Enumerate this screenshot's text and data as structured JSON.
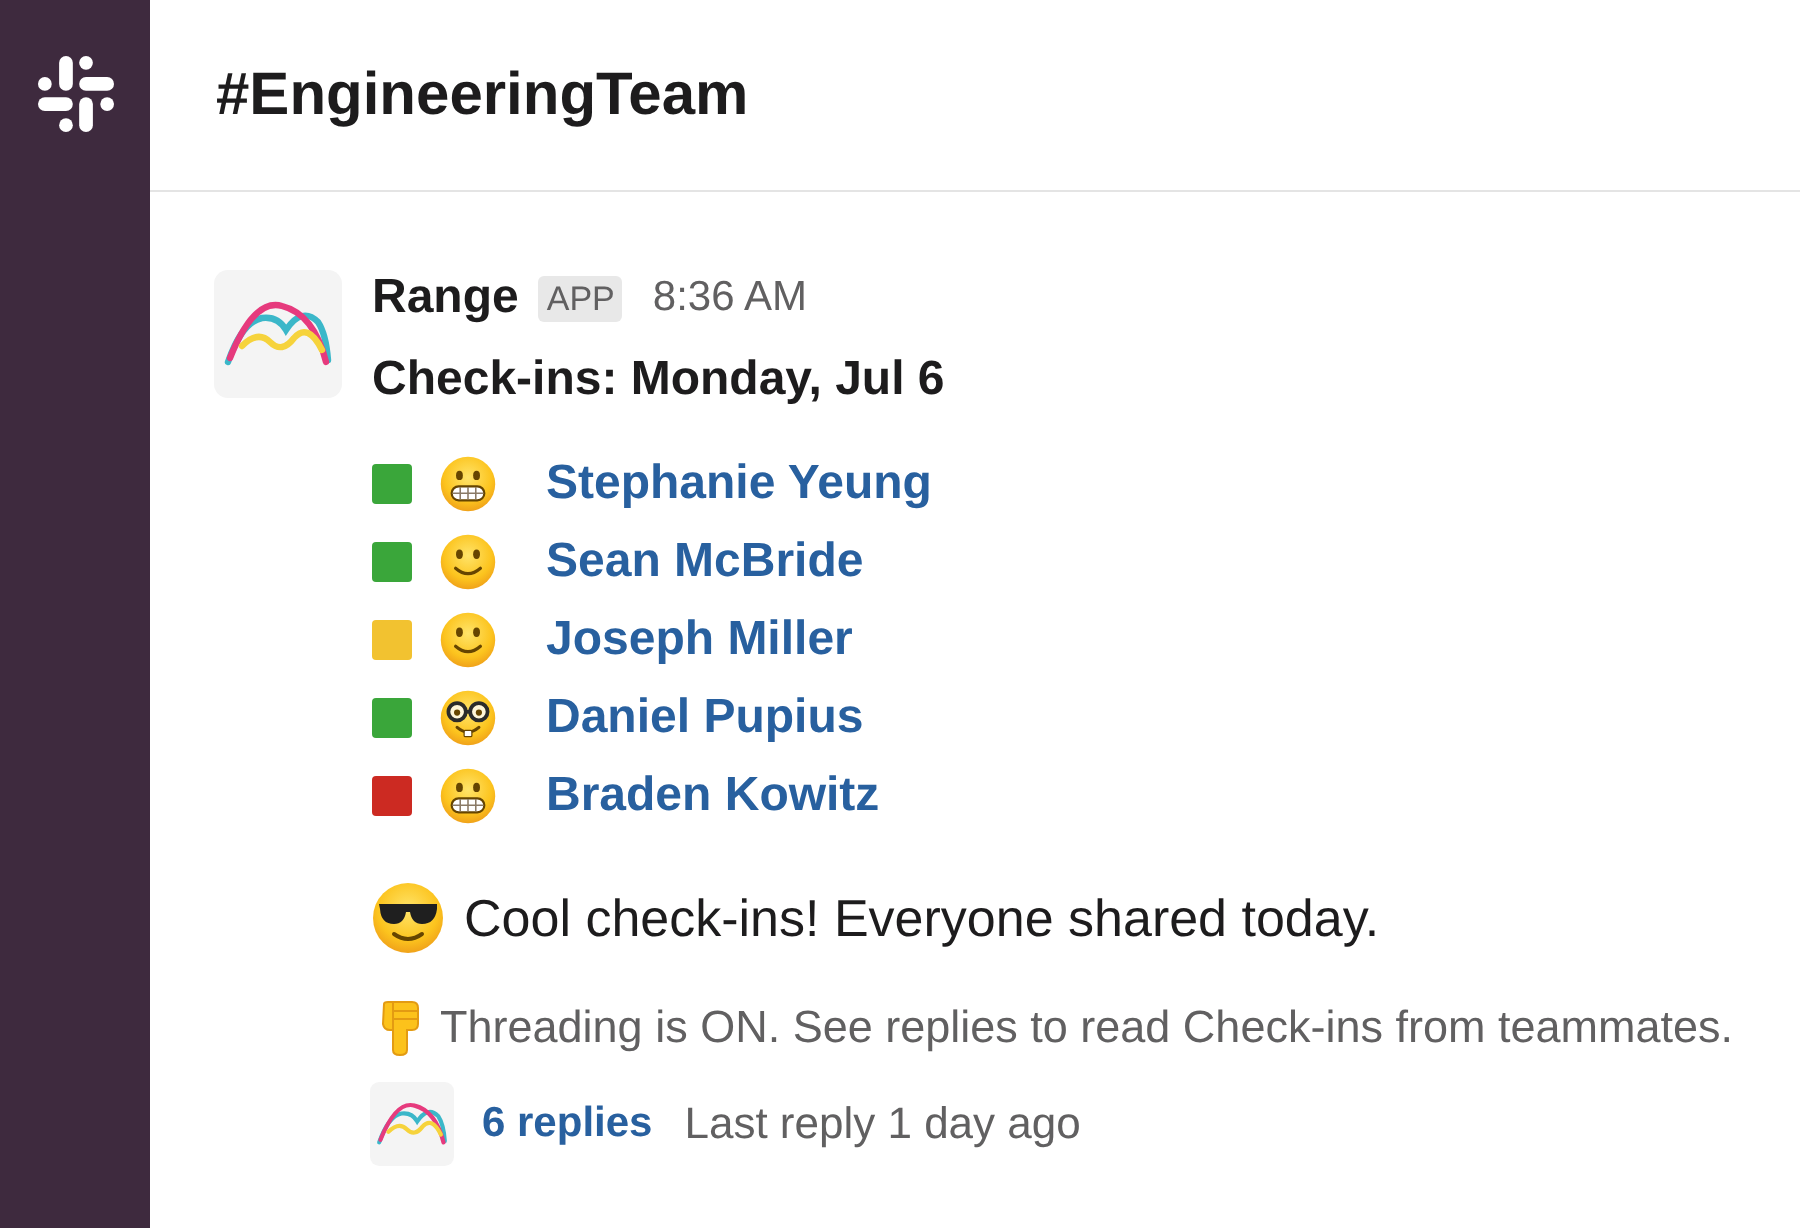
{
  "channel": {
    "title": "#EngineeringTeam"
  },
  "message": {
    "sender": "Range",
    "badge": "APP",
    "time": "8:36 AM",
    "heading": "Check-ins: Monday, Jul 6",
    "checkins": [
      {
        "name": "Stephanie Yeung",
        "color": "#3aa63a",
        "kind": "grimacing"
      },
      {
        "name": "Sean McBride",
        "color": "#3aa63a",
        "kind": "smiling"
      },
      {
        "name": "Joseph Miller",
        "color": "#f2c230",
        "kind": "smiling"
      },
      {
        "name": "Daniel Pupius",
        "color": "#3aa63a",
        "kind": "nerd"
      },
      {
        "name": "Braden Kowitz",
        "color": "#cc2a22",
        "kind": "grimacing"
      }
    ],
    "summary": "Cool check-ins! Everyone shared today.",
    "note": "Threading is ON. See replies to read Check-ins from teammates.",
    "thread": {
      "replies": "6 replies",
      "last_reply": "Last reply 1 day ago"
    }
  }
}
